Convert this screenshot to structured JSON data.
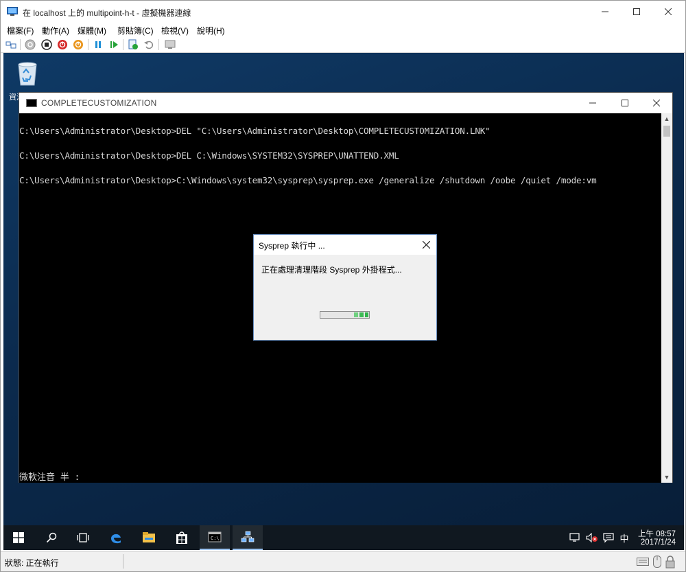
{
  "window": {
    "title": "在 localhost 上的 multipoint-h-t - 虛擬機器連線",
    "minimize_glyph": "—",
    "maximize_glyph": "☐",
    "close_glyph": "✕"
  },
  "menu": [
    {
      "label": "檔案(F)"
    },
    {
      "label": "動作(A)"
    },
    {
      "label": "媒體(M)"
    },
    {
      "label": "剪貼簿(C)"
    },
    {
      "label": "檢視(V)"
    },
    {
      "label": "說明(H)"
    }
  ],
  "toolbar": {
    "icons": [
      "ctrl-alt-del-icon",
      "start-icon",
      "turn-off-icon",
      "shutdown-icon",
      "power-save-icon",
      "pause-icon",
      "resume-icon",
      "checkpoint-icon",
      "revert-icon",
      "enhanced-session-icon"
    ]
  },
  "desktop": {
    "recycle_label": "資源回收筒"
  },
  "console": {
    "title": "COMPLETECUSTOMIZATION",
    "lines": [
      "C:\\Users\\Administrator\\Desktop>DEL \"C:\\Users\\Administrator\\Desktop\\COMPLETECUSTOMIZATION.LNK\"",
      "C:\\Users\\Administrator\\Desktop>DEL C:\\Windows\\SYSTEM32\\SYSPREP\\UNATTEND.XML",
      "C:\\Users\\Administrator\\Desktop>C:\\Windows\\system32\\sysprep\\sysprep.exe /generalize /shutdown /oobe /quiet /mode:vm"
    ],
    "ime_status": "微軟注音 半 :"
  },
  "sysprep_dialog": {
    "title": "Sysprep 執行中 ...",
    "message": "正在處理清理階段 Sysprep 外掛程式...",
    "progress_style": "marquee"
  },
  "taskbar": {
    "items": [
      "start-icon",
      "search-icon",
      "task-view-icon",
      "edge-icon",
      "file-explorer-icon",
      "store-icon",
      "cmd-icon",
      "network-app-icon"
    ],
    "tray_ime": "中",
    "clock_time": "上午 08:57",
    "clock_date": "2017/1/24"
  },
  "statusbar": {
    "text": "狀態: 正在執行"
  },
  "colors": {
    "console_text": "#d6d6d6",
    "progress_green": "#2fb34a",
    "taskbar_bg": "#101820",
    "desktop_blue": "#0b2a4d"
  }
}
